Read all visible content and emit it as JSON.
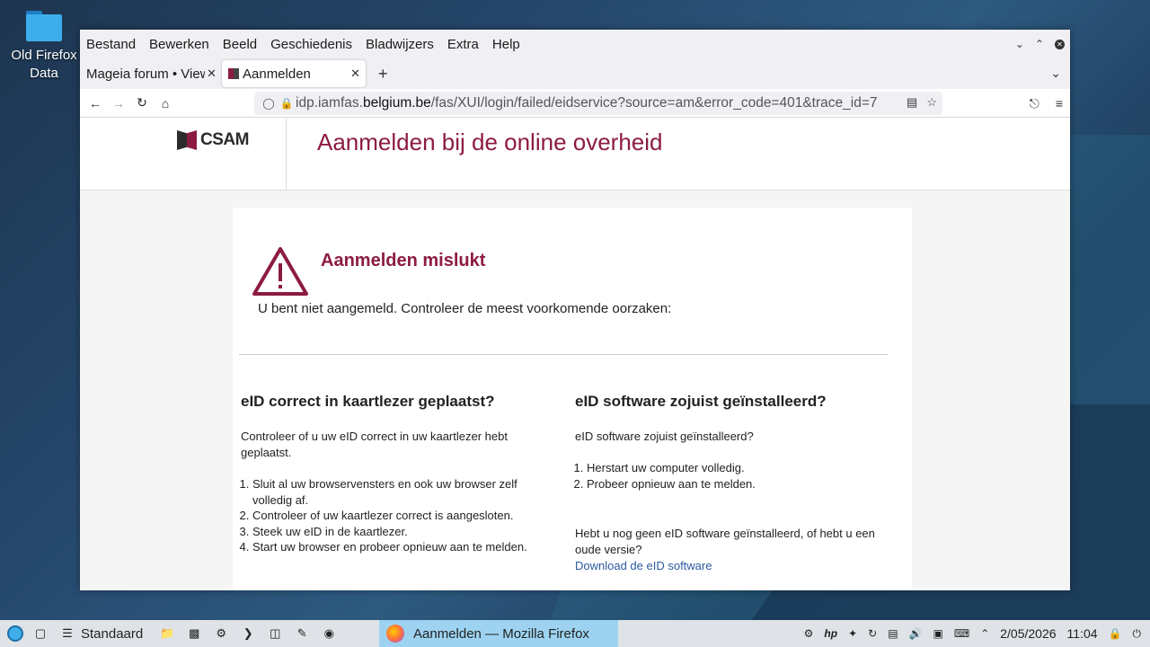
{
  "desktop": {
    "icon_label": "Old Firefox Data",
    "icon_label_line1": "Old Firefox",
    "icon_label_line2": "Data"
  },
  "menubar": {
    "items": [
      "Bestand",
      "Bewerken",
      "Beeld",
      "Geschiedenis",
      "Bladwijzers",
      "Extra",
      "Help"
    ]
  },
  "tabs": [
    {
      "label": "Mageia forum • View",
      "active": false
    },
    {
      "label": "Aanmelden",
      "active": true
    }
  ],
  "url": {
    "prefix": "idp.iamfas.",
    "host": "belgium.be",
    "path": "/fas/XUI/login/failed/eidservice?source=am&error_code=401&trace_id=7"
  },
  "page": {
    "logo_text": "CSAM",
    "site_title": "Aanmelden bij de online overheid",
    "error_title": "Aanmelden mislukt",
    "error_subtitle": "U bent niet aangemeld. Controleer de meest voorkomende oorzaken:",
    "left": {
      "heading": "eID correct in kaartlezer geplaatst?",
      "intro": "Controleer of u uw eID correct in uw kaartlezer hebt geplaatst.",
      "steps": [
        "Sluit al uw browservensters en ook uw browser zelf volledig af.",
        "Controleer of uw kaartlezer correct is aangesloten.",
        "Steek uw eID in de kaartlezer.",
        "Start uw browser en probeer opnieuw aan te melden."
      ]
    },
    "right": {
      "heading": "eID software zojuist geïnstalleerd?",
      "intro": "eID software zojuist geïnstalleerd?",
      "steps": [
        "Herstart uw computer volledig.",
        "Probeer opnieuw aan te melden."
      ],
      "more": "Hebt u nog geen eID software geïnstalleerd, of hebt u een oude versie?",
      "link": "Download de eID software"
    }
  },
  "taskbar": {
    "activity": "Standaard",
    "active_window": "Aanmelden — Mozilla Firefox",
    "date": "2/05/2026",
    "time": "11:04"
  },
  "colors": {
    "accent": "#8c1c3f",
    "link": "#2c5aa0",
    "taskbar_active": "#9dd3f0"
  }
}
